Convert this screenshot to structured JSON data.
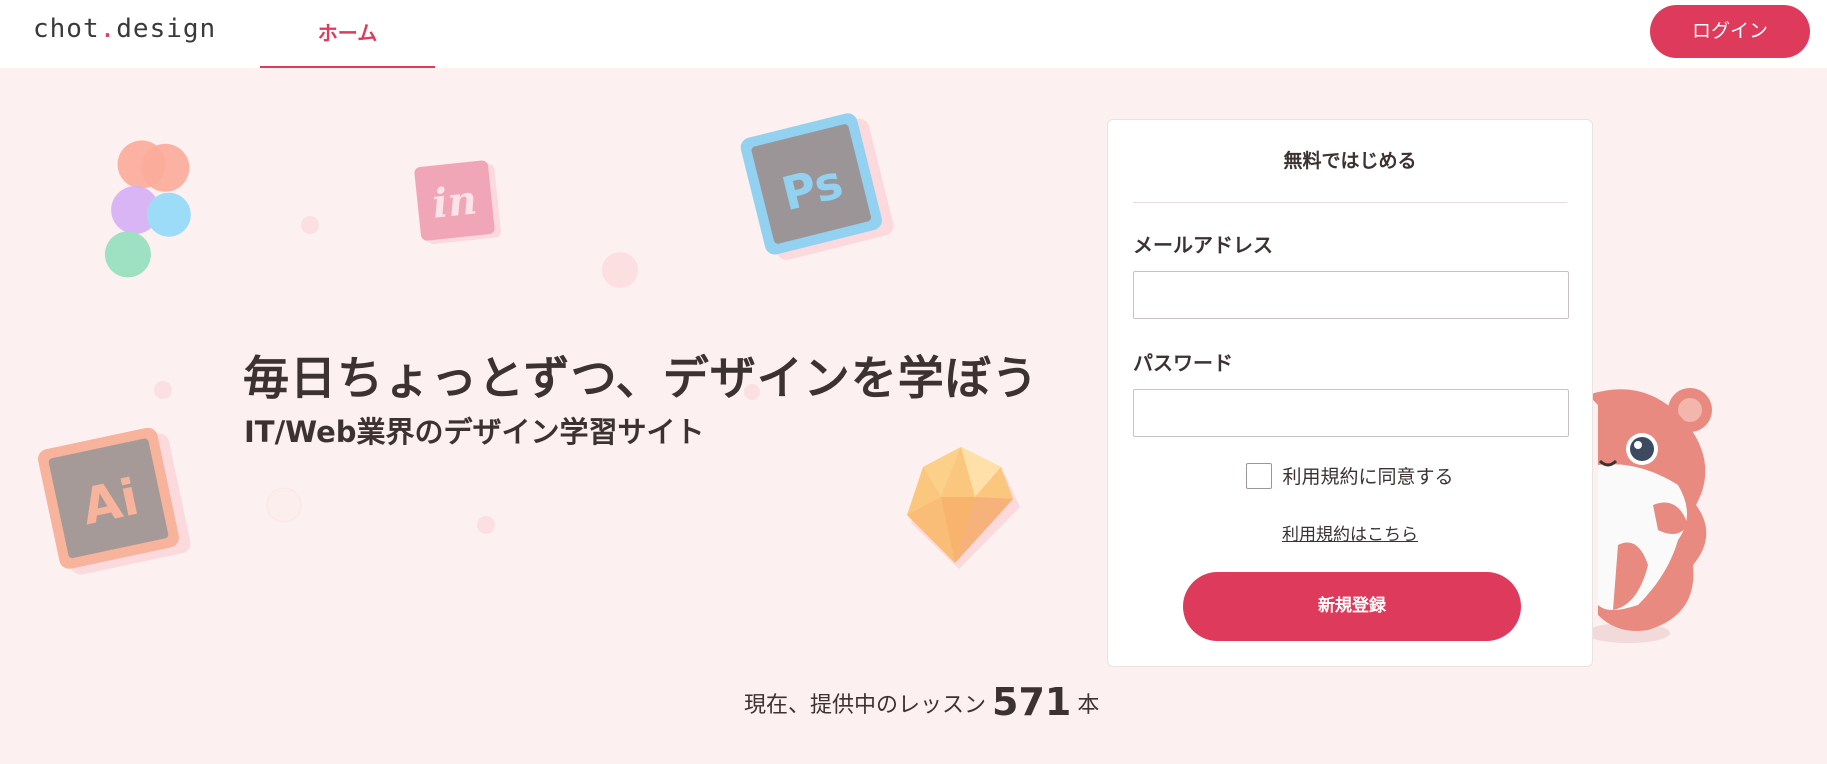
{
  "header": {
    "logo_left": "chot",
    "logo_dot": ".",
    "logo_right": "design",
    "nav_home": "ホーム",
    "login_label": "ログイン"
  },
  "hero": {
    "title": "毎日ちょっとずつ、デザインを学ぼう",
    "subtitle": "IT/Web業界のデザイン学習サイト"
  },
  "signup_form": {
    "title": "無料ではじめる",
    "email_label": "メールアドレス",
    "email_value": "",
    "password_label": "パスワード",
    "password_value": "",
    "agree_label": "利用規約に同意する",
    "terms_link": "利用規約はこちら",
    "submit_label": "新規登録"
  },
  "lessons": {
    "prefix": "現在、提供中のレッスン",
    "count": "571",
    "suffix": "本"
  },
  "decorations": {
    "icons": [
      "figma-icon",
      "invision-icon",
      "photoshop-icon",
      "illustrator-icon",
      "sketch-icon",
      "hamster-mascot"
    ],
    "invision_text": "in",
    "photoshop_text": "Ps",
    "illustrator_text": "Ai"
  },
  "colors": {
    "accent": "#dd3a5c",
    "background": "#fdf0f0",
    "text": "#3c3232"
  }
}
